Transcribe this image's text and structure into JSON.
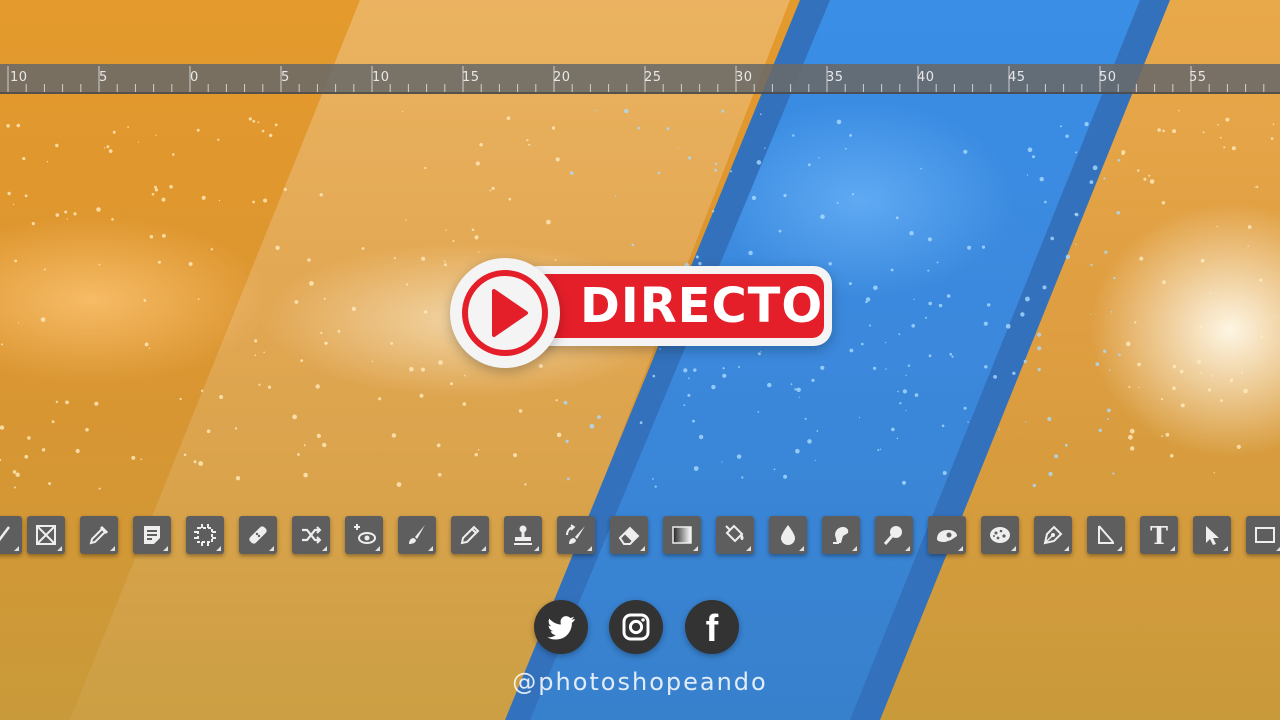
{
  "ruler": {
    "labels": [
      "10",
      "5",
      "0",
      "5",
      "10",
      "15",
      "20",
      "25",
      "30",
      "35",
      "40",
      "45",
      "50",
      "55"
    ]
  },
  "badge": {
    "label": "DIRECTO",
    "color": "#e41f2a"
  },
  "toolbar": {
    "tools": [
      "lasso-icon",
      "frame-icon",
      "eyedropper-icon",
      "note-icon",
      "patch-icon",
      "bandage-icon",
      "content-aware-move-icon",
      "red-eye-icon",
      "brush-icon",
      "pencil-icon",
      "stamp-icon",
      "history-brush-icon",
      "eraser-icon",
      "gradient-icon",
      "paint-bucket-icon",
      "blur-icon",
      "smudge-icon",
      "dodge-icon",
      "burn-icon",
      "sponge-icon",
      "pen-icon",
      "freeform-icon",
      "type-icon",
      "path-selection-icon",
      "rectangle-icon"
    ],
    "type_glyph": "T"
  },
  "social": {
    "icons": [
      "twitter-icon",
      "instagram-icon",
      "facebook-icon"
    ],
    "facebook_glyph": "f",
    "handle": "@photoshopeando"
  }
}
